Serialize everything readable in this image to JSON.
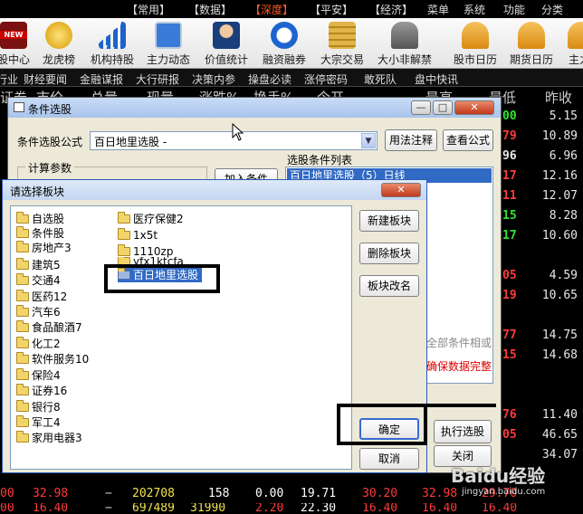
{
  "menubar": {
    "items": [
      "【常用】",
      "【数据】",
      "【深度】",
      "【平安】",
      "【经济】",
      "菜单",
      "系统",
      "功能",
      "分类"
    ]
  },
  "toolbar": {
    "items": [
      "股中心",
      "龙虎榜",
      "机构持股",
      "主力动态",
      "价值统计",
      "融资融券",
      "大宗交易",
      "大小非解禁",
      "股市日历",
      "期货日历",
      "主力"
    ],
    "badge": "NEW"
  },
  "tabs": [
    "行业",
    "财经要闻",
    "金融谋报",
    "大行研报",
    "决策内参",
    "操盘必读",
    "涨停密码",
    "敢死队",
    "盘中快讯"
  ],
  "quote_header": [
    "证券",
    "市价",
    "总量",
    "现量",
    "涨跌%",
    "换手%",
    "今开",
    "最高",
    "最低",
    "昨收"
  ],
  "quotes_right": [
    "5.15",
    "10.89",
    "6.96",
    "12.16",
    "12.07",
    "8.28",
    "10.60",
    "4.59",
    "10.65",
    "14.75",
    "14.68",
    "11.40",
    "46.65",
    "34.07"
  ],
  "quotes_left": [
    "00",
    "79",
    "96",
    "17",
    "11",
    "15",
    "17",
    "05",
    "19",
    "77",
    "15",
    "76",
    "05",
    ""
  ],
  "bottom_row": {
    "a": "00",
    "b": "32.98",
    "c": "−",
    "d": "202708",
    "e": "158",
    "f": "0.00",
    "g": "19.71",
    "h": "30.20",
    "i": "32.98",
    "j": "29.70"
  },
  "bottom_row2": {
    "a": "00",
    "b": "16.40",
    "c": "−",
    "d": "697489",
    "e": "31990",
    "f": "2.20",
    "g": "22.30",
    "h": "16.40",
    "i": "16.40",
    "j": "16.40"
  },
  "condition_dialog": {
    "title": "条件选股",
    "formula_label": "条件选股公式",
    "formula_value": "百日地里选股 -",
    "usage_button": "用法注释",
    "view_button": "查看公式",
    "params_label": "计算参数",
    "add_button": "加入条件",
    "list_label": "选股条件列表",
    "list_selected": "百日地里选股（5）日线",
    "relation_text": "全部条件相或",
    "warning_text": "确保数据完整",
    "run_button": "执行选股",
    "close_button": "关闭"
  },
  "board_dialog": {
    "title": "请选择板块",
    "col1": [
      "自选股",
      "条件股",
      "房地产3",
      "建筑5",
      "交通4",
      "医药12",
      "汽车6",
      "食品酿酒7",
      "化工2",
      "软件服务10",
      "保险4",
      "证券16",
      "银行8",
      "军工4",
      "家用电器3"
    ],
    "col2": [
      "医疗保健2",
      "1x5t",
      "1110zp",
      "yfx1ktcfa",
      "百日地里选股"
    ],
    "new_button": "新建板块",
    "delete_button": "删除板块",
    "rename_button": "板块改名",
    "ok_button": "确定",
    "cancel_button": "取消"
  },
  "watermark": {
    "brand": "Baidu经验",
    "url": "jingyan.baidu.com"
  }
}
